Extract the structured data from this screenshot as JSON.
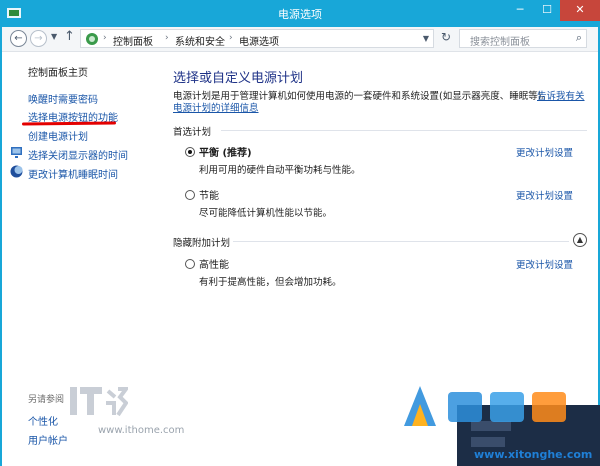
{
  "window": {
    "title": "电源选项",
    "controls": {
      "minimize": "─",
      "maximize": "☐",
      "close": "✕"
    }
  },
  "nav": {
    "back_icon": "back-arrow-icon",
    "forward_icon": "forward-arrow-icon",
    "recent_icon": "chevron-down-icon",
    "up_icon": "up-arrow-icon",
    "breadcrumbs": [
      "控制面板",
      "系统和安全",
      "电源选项"
    ],
    "refresh_icon": "refresh-icon",
    "search_placeholder": "搜索控制面板"
  },
  "sidebar": {
    "home": "控制面板主页",
    "items": [
      {
        "label": "唤醒时需要密码"
      },
      {
        "label": "选择电源按钮的功能",
        "highlighted": true
      },
      {
        "label": "创建电源计划"
      },
      {
        "label": "选择关闭显示器的时间",
        "icon": "monitor-icon"
      },
      {
        "label": "更改计算机睡眠时间",
        "icon": "moon-icon"
      }
    ],
    "see_also": {
      "heading": "另请参阅",
      "items": [
        "个性化",
        "用户帐户"
      ]
    }
  },
  "main": {
    "title": "选择或自定义电源计划",
    "desc_line1": "电源计划是用于管理计算机如何使用电源的一套硬件和系统设置(如显示器亮度、睡眠等)。",
    "desc_link_a": "告诉我有关",
    "desc_link_b": "电源计划的详细信息",
    "preferred": {
      "heading": "首选计划",
      "plans": [
        {
          "name": "平衡 (推荐)",
          "desc": "利用可用的硬件自动平衡功耗与性能。",
          "change": "更改计划设置",
          "selected": true
        },
        {
          "name": "节能",
          "desc": "尽可能降低计算机性能以节能。",
          "change": "更改计划设置",
          "selected": false
        }
      ]
    },
    "hidden": {
      "heading": "隐藏附加计划",
      "plans": [
        {
          "name": "高性能",
          "desc": "有利于提高性能，但会增加功耗。",
          "change": "更改计划设置",
          "selected": false
        }
      ]
    }
  },
  "watermarks": {
    "ithome_url": "www.ithome.com",
    "xitonghe_url": "www.xitonghe.com"
  },
  "colors": {
    "titlebar": "#18a7d8",
    "heading_blue": "#1e3287",
    "link_blue": "#1a56a8",
    "highlight_red": "#e30000"
  }
}
